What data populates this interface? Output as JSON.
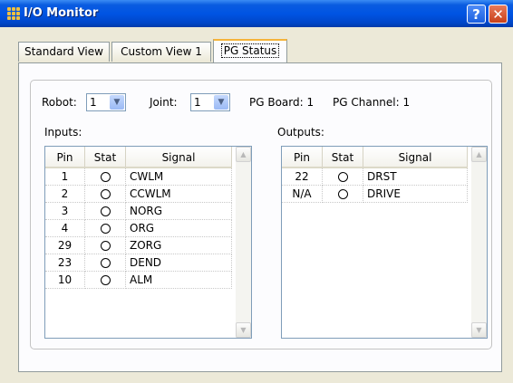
{
  "window": {
    "title": "I/O Monitor",
    "help_glyph": "?",
    "close_glyph": "✕"
  },
  "tabs": [
    {
      "label": "Standard View",
      "active": false
    },
    {
      "label": "Custom View 1",
      "active": false
    },
    {
      "label": "PG Status",
      "active": true
    }
  ],
  "controls": {
    "robot_label": "Robot:",
    "robot_value": "1",
    "joint_label": "Joint:",
    "joint_value": "1",
    "pg_board": "PG Board: 1",
    "pg_channel": "PG Channel: 1"
  },
  "inputs": {
    "label": "Inputs:",
    "columns": [
      "Pin",
      "Stat",
      "Signal"
    ],
    "rows": [
      {
        "pin": "1",
        "signal": "CWLM"
      },
      {
        "pin": "2",
        "signal": "CCWLM"
      },
      {
        "pin": "3",
        "signal": "NORG"
      },
      {
        "pin": "4",
        "signal": "ORG"
      },
      {
        "pin": "29",
        "signal": "ZORG"
      },
      {
        "pin": "23",
        "signal": "DEND"
      },
      {
        "pin": "10",
        "signal": "ALM"
      }
    ]
  },
  "outputs": {
    "label": "Outputs:",
    "columns": [
      "Pin",
      "Stat",
      "Signal"
    ],
    "rows": [
      {
        "pin": "22",
        "signal": "DRST"
      },
      {
        "pin": "N/A",
        "signal": "DRIVE"
      }
    ]
  },
  "icons": {
    "scroll_up": "up-arrow",
    "scroll_down": "down-arrow",
    "dropdown": "chevron-down",
    "status_off": "empty-circle"
  }
}
